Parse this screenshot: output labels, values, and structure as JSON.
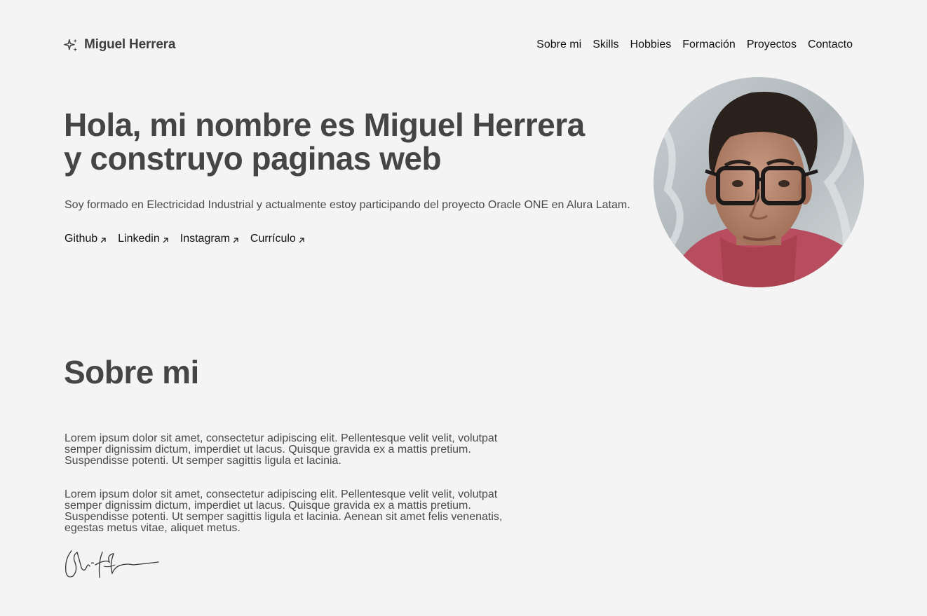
{
  "header": {
    "logo_text": "Miguel Herrera",
    "logo_icon": "sparkles-icon",
    "nav": [
      {
        "label": "Sobre mi"
      },
      {
        "label": "Skills"
      },
      {
        "label": "Hobbies"
      },
      {
        "label": "Formación"
      },
      {
        "label": "Proyectos"
      },
      {
        "label": "Contacto"
      }
    ]
  },
  "hero": {
    "title_line1": "Hola, mi nombre es Miguel Herrera",
    "title_line2": "y construyo paginas web",
    "description": "Soy formado en Electricidad Industrial y actualmente estoy participando del proyecto Oracle ONE en Alura Latam.",
    "links": [
      {
        "label": "Github",
        "icon": "arrow-up-right-icon"
      },
      {
        "label": "Linkedin",
        "icon": "arrow-up-right-icon"
      },
      {
        "label": "Instagram",
        "icon": "arrow-up-right-icon"
      },
      {
        "label": "Currículo",
        "icon": "arrow-up-right-icon"
      }
    ]
  },
  "about": {
    "title": "Sobre mi",
    "paragraph_1": "Lorem ipsum dolor sit amet, consectetur adipiscing elit. Pellentesque velit velit, volutpat semper dignissim dictum, imperdiet ut lacus. Quisque gravida ex a mattis pretium. Suspendisse potenti. Ut semper sagittis ligula et lacinia.",
    "paragraph_2": "Lorem ipsum dolor sit amet, consectetur adipiscing elit. Pellentesque velit velit, volutpat semper dignissim dictum, imperdiet ut lacus. Quisque gravida ex a mattis pretium. Suspendisse potenti. Ut semper sagittis ligula et lacinia. Aenean sit amet felis venenatis, egestas metus vitae, aliquet metus."
  },
  "colors": {
    "background": "#f4f4f4",
    "heading": "#454545",
    "body_text": "#4a4a4a",
    "link": "#111111"
  }
}
